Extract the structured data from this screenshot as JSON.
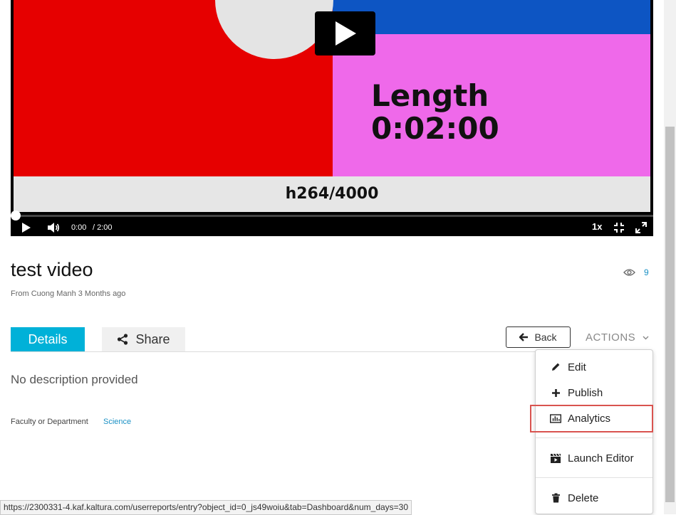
{
  "player": {
    "video_frame": {
      "length_label": "Length",
      "length_value": "0:02:00",
      "codec_label": "h264/4000"
    },
    "current_time": "0:00",
    "duration": "/ 2:00",
    "speed": "1x",
    "progress": 0,
    "icons": [
      "big-play-icon",
      "play-icon",
      "volume-icon",
      "fullscreen-icon",
      "expand-icon"
    ]
  },
  "entry": {
    "title": "test video",
    "byline": "From Cuong Manh 3 Months ago",
    "views": "9"
  },
  "tabs": {
    "details": "Details",
    "share": "Share"
  },
  "toolbar": {
    "back": "Back",
    "actions": "ACTIONS"
  },
  "details": {
    "description": "No description provided",
    "field_label": "Faculty or Department",
    "field_value": "Science"
  },
  "actions_menu": {
    "items": [
      {
        "label": "Edit",
        "icon": "pencil-icon"
      },
      {
        "label": "Publish",
        "icon": "plus-icon"
      },
      {
        "label": "Analytics",
        "icon": "bar-chart-icon",
        "highlighted": true
      },
      {
        "label": "Launch Editor",
        "icon": "clapperboard-icon"
      },
      {
        "label": "Delete",
        "icon": "trash-icon"
      }
    ]
  },
  "status_bar": {
    "url": "https://2300331-4.kaf.kaltura.com/userreports/entry?object_id=0_js49woiu&tab=Dashboard&num_days=30"
  },
  "colors": {
    "accent": "#00b1d8",
    "link": "#1b91c5",
    "highlight_border": "#d9534f"
  }
}
